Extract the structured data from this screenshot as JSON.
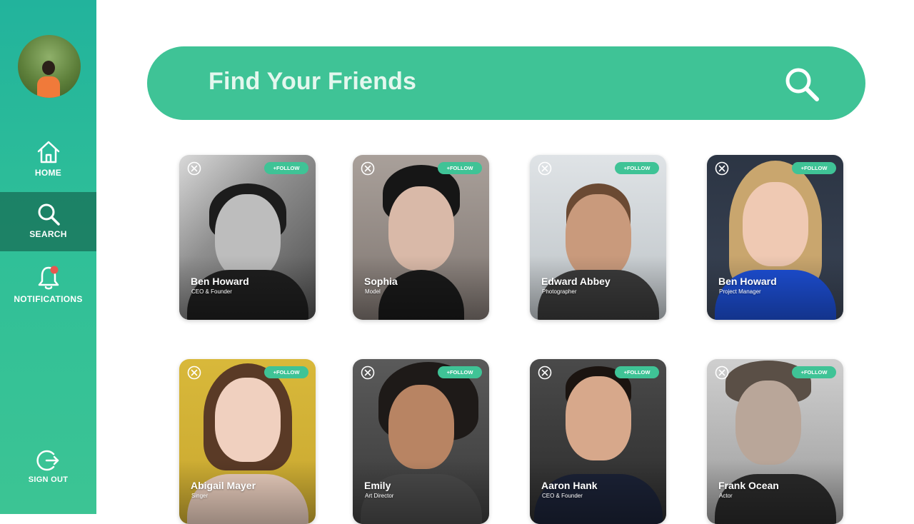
{
  "sidebar": {
    "nav": {
      "home": "HOME",
      "search": "SEARCH",
      "notifications": "NOTIFICATIONS",
      "sign_out": "SIGN OUT"
    },
    "notification_dot_color": "#e8574f"
  },
  "search": {
    "placeholder": "Find Your Friends"
  },
  "colors": {
    "accent": "#3fc396",
    "sidebar_active": "#1d6e5a"
  },
  "cards": [
    {
      "name": "Ben Howard",
      "role": "CEO & Founder",
      "follow_label": "+FOLLOW"
    },
    {
      "name": "Sophia",
      "role": "Model",
      "follow_label": "+FOLLOW"
    },
    {
      "name": "Edward Abbey",
      "role": "Photographer",
      "follow_label": "+FOLLOW"
    },
    {
      "name": "Ben Howard",
      "role": "Project Manager",
      "follow_label": "+FOLLOW"
    },
    {
      "name": "Abigail Mayer",
      "role": "Singer",
      "follow_label": "+FOLLOW"
    },
    {
      "name": "Emily",
      "role": "Art Director",
      "follow_label": "+FOLLOW"
    },
    {
      "name": "Aaron Hank",
      "role": "CEO & Founder",
      "follow_label": "+FOLLOW"
    },
    {
      "name": "Frank Ocean",
      "role": "Actor",
      "follow_label": "+FOLLOW"
    }
  ]
}
